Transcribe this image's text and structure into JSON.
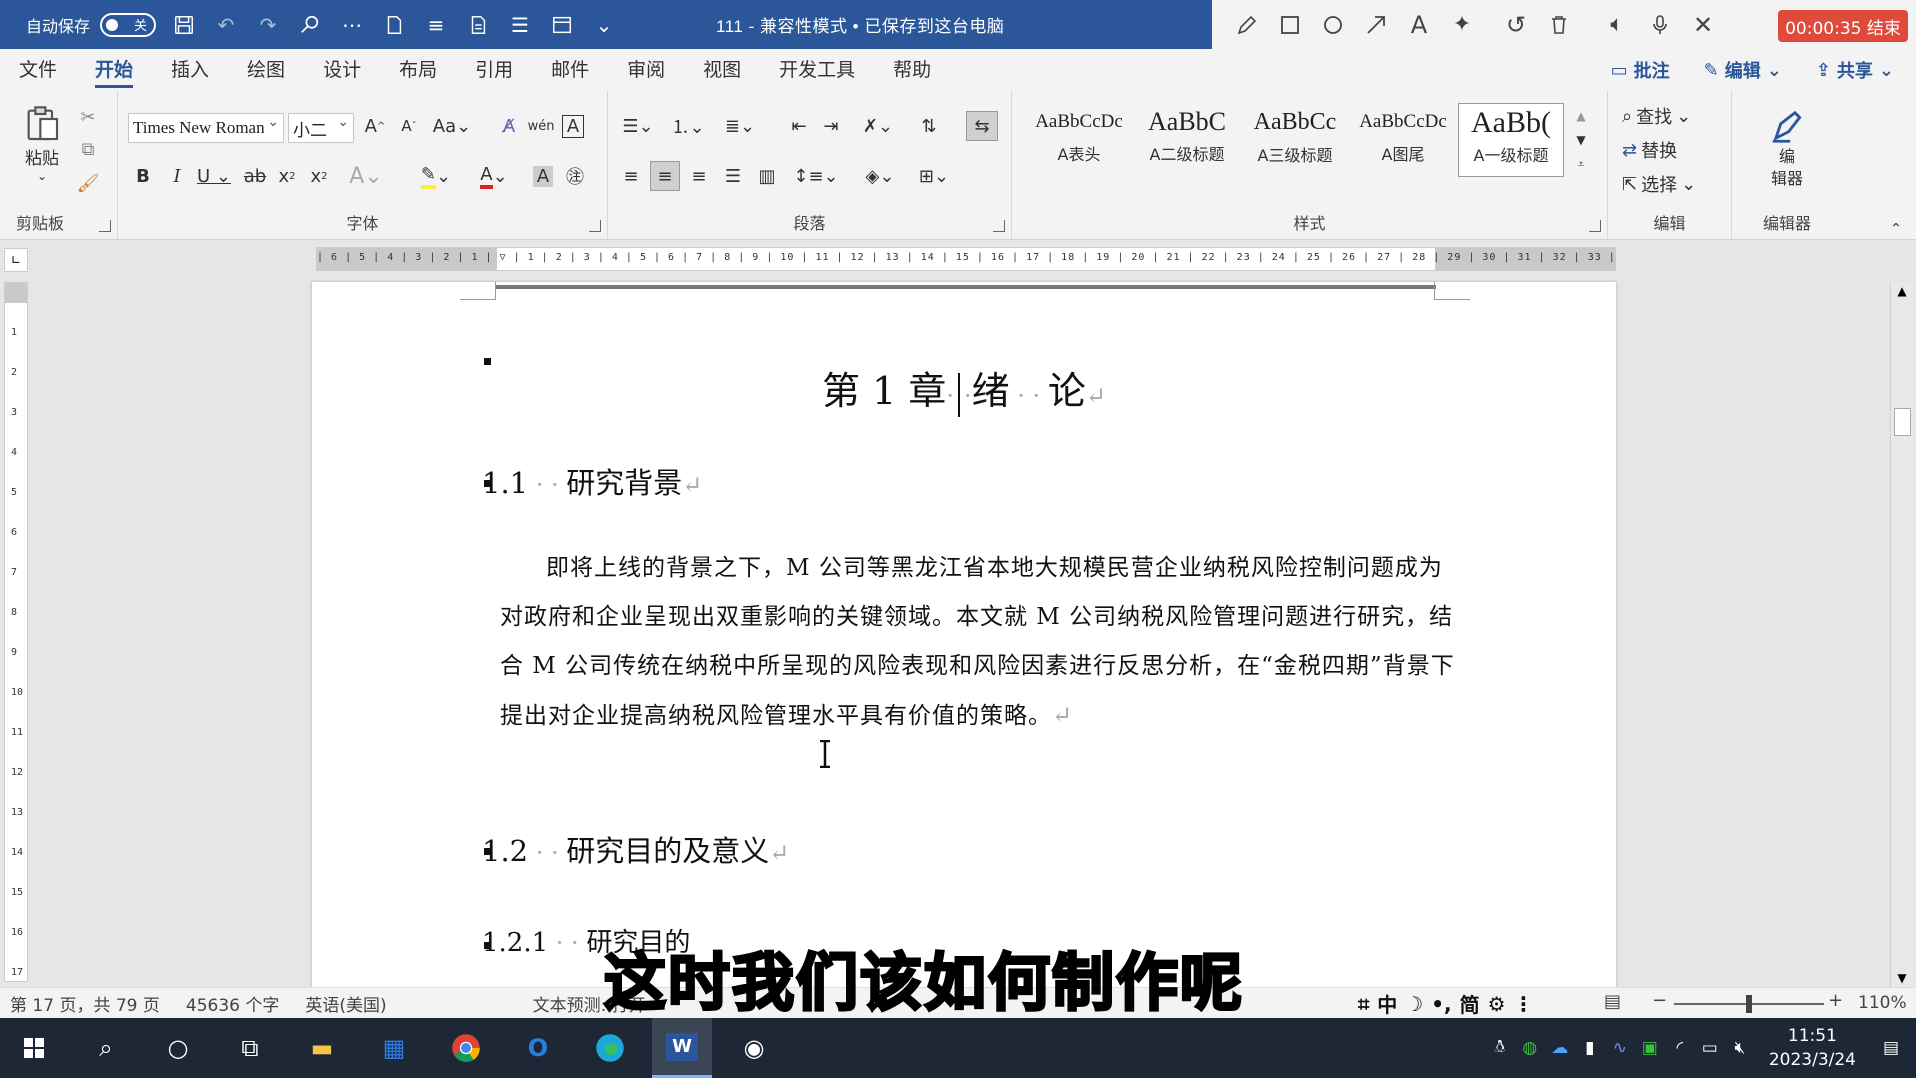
{
  "titlebar": {
    "autosave_label": "自动保存",
    "autosave_state": "关",
    "doc_title": "111  -  兼容性模式 • 已保存到这台电脑",
    "recording_label": "00:00:35 结束"
  },
  "menu": {
    "tabs": [
      "文件",
      "开始",
      "插入",
      "绘图",
      "设计",
      "布局",
      "引用",
      "邮件",
      "审阅",
      "视图",
      "开发工具",
      "帮助"
    ],
    "active_tab": "开始",
    "comment_label": "批注",
    "edit_label": "编辑",
    "share_label": "共享"
  },
  "ribbon": {
    "clipboard": {
      "label": "剪贴板",
      "paste_label": "粘贴"
    },
    "font": {
      "label": "字体",
      "font_name": "Times New Roman",
      "font_size": "小二"
    },
    "paragraph": {
      "label": "段落"
    },
    "styles": {
      "label": "样式",
      "items": [
        {
          "preview": "AaBbCcDc",
          "name": "A表头"
        },
        {
          "preview": "AaBbC",
          "name": "A二级标题"
        },
        {
          "preview": "AaBbCc",
          "name": "A三级标题"
        },
        {
          "preview": "AaBbCcDc",
          "name": "A图尾"
        },
        {
          "preview": "AaBb(",
          "name": "A一级标题"
        }
      ]
    },
    "editing": {
      "label": "编辑",
      "find": "查找",
      "replace": "替换",
      "select": "选择"
    },
    "editor": {
      "label": "编辑器",
      "button": "编\n辑器"
    }
  },
  "document": {
    "chapter_title": "第 1 章",
    "chapter_title_2": "绪",
    "chapter_title_3": "论",
    "sec_1_1_num": "1.1",
    "sec_1_1_title": "研究背景",
    "paragraph": "即将上线的背景之下，M 公司等黑龙江省本地大规模民营企业纳税风险控制问题成为对政府和企业呈现出双重影响的关键领域。本文就 M 公司纳税风险管理问题进行研究，结合 M 公司传统在纳税中所呈现的风险表现和风险因素进行反思分析，在“金税四期”背景下提出对企业提高纳税风险管理水平具有价值的策略。",
    "sec_1_2_num": "1.2",
    "sec_1_2_title": "研究目的及意义",
    "sec_1_2_1_num": "1.2.1",
    "sec_1_2_1_title": "研究目的",
    "para_mark": "↵"
  },
  "statusbar": {
    "page": "第 17 页，共 79 页",
    "words": "45636 个字",
    "language": "英语(美国)",
    "prediction": "文本预测: 打开",
    "zoom": "110%",
    "ime": "中",
    "ime_mode": "简"
  },
  "subtitle": "这时我们该如何制作呢",
  "taskbar": {
    "time": "11:51",
    "date": "2023/3/24"
  }
}
